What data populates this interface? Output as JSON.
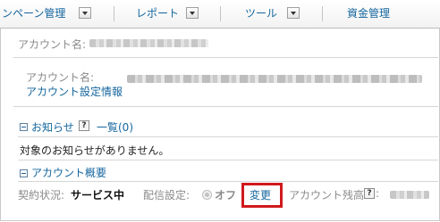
{
  "nav": {
    "campaign_label": "ンペーン管理",
    "report_label": "レポート",
    "tools_label": "ツール",
    "funds_label": "資金管理"
  },
  "account_header": {
    "account_name_label": "アカウント名:"
  },
  "account_box": {
    "account_name_label": "アカウント名:",
    "settings_link": "アカウント設定情報"
  },
  "notices": {
    "title": "お知らせ",
    "help_icon": "?",
    "list_link": "一覧(0)",
    "message": "対象のお知らせがありません。"
  },
  "overview": {
    "title": "アカウント概要",
    "contract_label": "契約状況:",
    "contract_value": "サービス中",
    "delivery_label": "配信設定:",
    "delivery_value": "オフ",
    "change_link": "変更",
    "balance_label": "アカウント残高",
    "balance_help": "?",
    "balance_colon": ":"
  },
  "icons": {
    "dropdown": "chevron-down-icon",
    "collapse": "minus-box-icon",
    "help": "question-mark-icon",
    "radio": "radio-icon"
  },
  "colors": {
    "link": "#14669e",
    "highlight": "#d0191c",
    "label": "#8a8a8a"
  }
}
